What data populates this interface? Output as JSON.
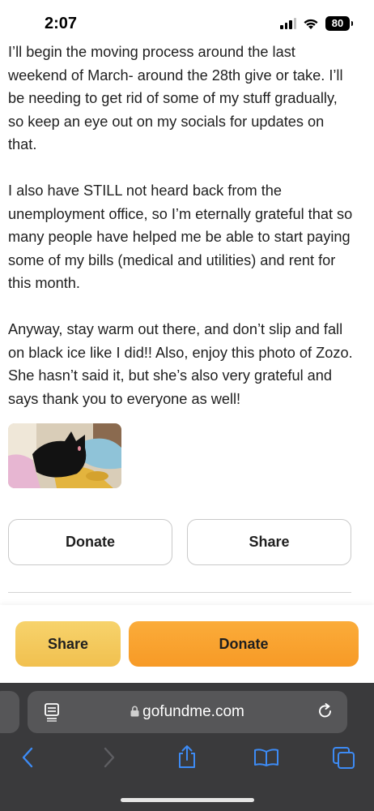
{
  "status_bar": {
    "time": "2:07",
    "battery": "80"
  },
  "article": {
    "paragraphs": [
      "I’ll begin the moving process around the last weekend of March- around the 28th give or take. I’ll be needing to get rid of some of my stuff gradually, so keep an eye out on my socials for updates on that.",
      "I also have STILL not heard back from the unemployment office, so I’m eternally grateful that so many people have helped me be able to start paying some of my bills (medical and utilities) and rent for this month.",
      "Anyway, stay warm out there, and don’t slip and fall on black ice like I did!! Also, enjoy this photo of Zozo. She hasn’t said it, but she’s also very grateful and says thank you to everyone as well!"
    ]
  },
  "actions": {
    "donate_label": "Donate",
    "share_label": "Share"
  },
  "sticky_bar": {
    "share_label": "Share",
    "donate_label": "Donate"
  },
  "browser": {
    "url": "gofundme.com"
  },
  "colors": {
    "accent_yellow": "#f1c04f",
    "accent_orange": "#f79a26",
    "safari_blue": "#3d8bf5"
  }
}
